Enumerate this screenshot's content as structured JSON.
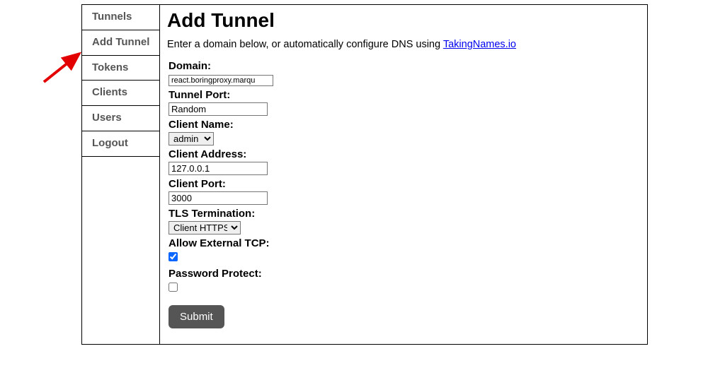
{
  "sidebar": {
    "items": [
      {
        "label": "Tunnels"
      },
      {
        "label": "Add Tunnel"
      },
      {
        "label": "Tokens"
      },
      {
        "label": "Clients"
      },
      {
        "label": "Users"
      },
      {
        "label": "Logout"
      }
    ]
  },
  "main": {
    "heading": "Add Tunnel",
    "intro_prefix": "Enter a domain below, or automatically configure DNS using ",
    "intro_link_text": "TakingNames.io",
    "intro_link_href": "#"
  },
  "form": {
    "domain": {
      "label": "Domain:",
      "value": "react.boringproxy.marqu"
    },
    "tunnel_port": {
      "label": "Tunnel Port:",
      "value": "Random"
    },
    "client_name": {
      "label": "Client Name:",
      "selected": "admin"
    },
    "client_address": {
      "label": "Client Address:",
      "value": "127.0.0.1"
    },
    "client_port": {
      "label": "Client Port:",
      "value": "3000"
    },
    "tls_termination": {
      "label": "TLS Termination:",
      "selected": "Client HTTPS"
    },
    "allow_external_tcp": {
      "label": "Allow External TCP:",
      "checked": true
    },
    "password_protect": {
      "label": "Password Protect:",
      "checked": false
    },
    "submit_label": "Submit"
  }
}
